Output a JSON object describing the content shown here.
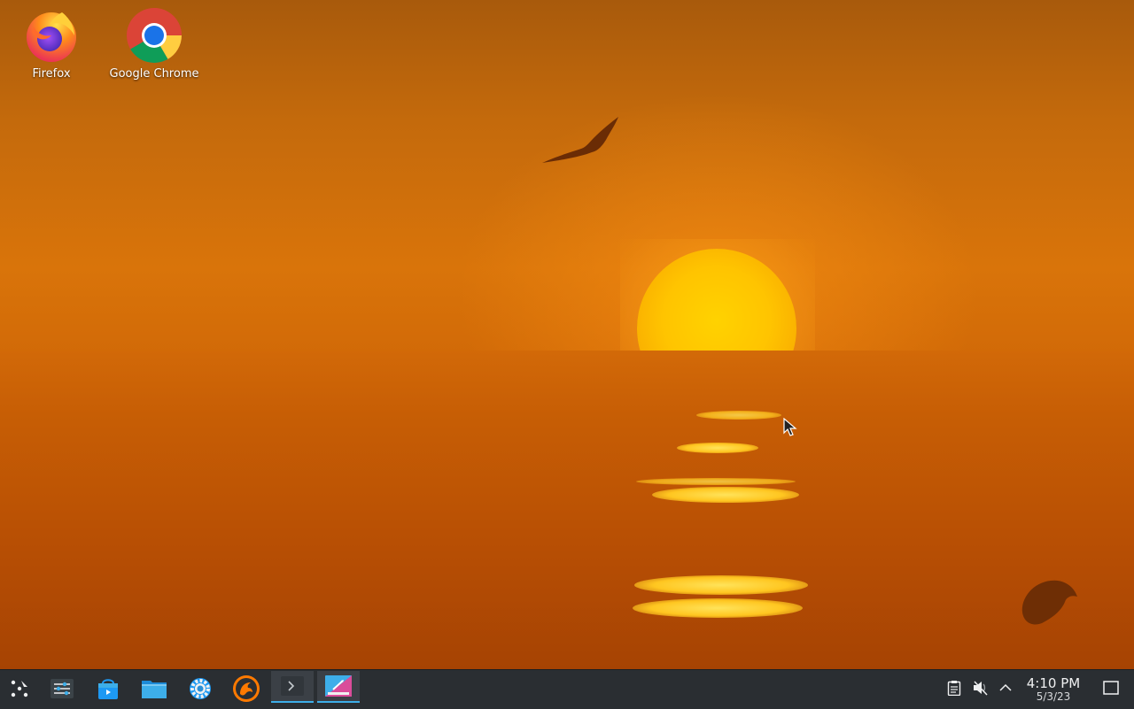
{
  "desktop": {
    "icons": [
      {
        "label": "Firefox",
        "icon": "firefox-icon"
      },
      {
        "label": "Google Chrome",
        "icon": "chrome-icon"
      }
    ],
    "wallpaper": "sunset-over-sea"
  },
  "taskbar": {
    "launcher": {
      "icon": "application-launcher-icon"
    },
    "pinned": [
      {
        "icon": "system-settings-sliders-icon"
      },
      {
        "icon": "discover-store-icon"
      },
      {
        "icon": "dolphin-file-manager-icon"
      },
      {
        "icon": "settings-gear-icon"
      },
      {
        "icon": "steam-like-dragon-icon"
      },
      {
        "icon": "terminal-icon",
        "active": true
      },
      {
        "icon": "screenshot-tool-icon",
        "active": true
      }
    ],
    "tray": [
      {
        "icon": "clipboard-icon"
      },
      {
        "icon": "volume-muted-icon"
      },
      {
        "icon": "expand-tray-chevron-icon"
      }
    ],
    "clock": {
      "time": "4:10 PM",
      "date": "5/3/23"
    },
    "show_desktop": {
      "icon": "show-desktop-icon"
    }
  },
  "colors": {
    "taskbar_bg": "#2a2e32",
    "accent": "#3daee9",
    "sun": "#ffc400"
  }
}
